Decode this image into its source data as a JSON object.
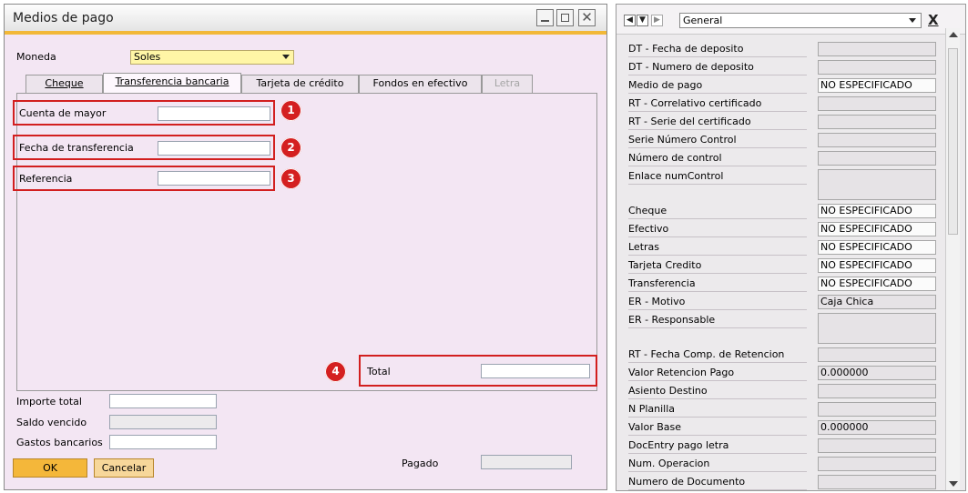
{
  "window": {
    "title": "Medios de pago"
  },
  "moneda": {
    "label": "Moneda",
    "value": "Soles"
  },
  "tabs": [
    {
      "label": "Cheque",
      "active": false,
      "disabled": false
    },
    {
      "label": "Transferencia bancaria",
      "active": true,
      "disabled": false
    },
    {
      "label": "Tarjeta de crédito",
      "active": false,
      "disabled": false
    },
    {
      "label": "Fondos en efectivo",
      "active": false,
      "disabled": false
    },
    {
      "label": "Letra",
      "active": false,
      "disabled": true
    }
  ],
  "transfer_fields": [
    {
      "label": "Cuenta de mayor",
      "value": "",
      "badge": "1"
    },
    {
      "label": "Fecha de transferencia",
      "value": "",
      "badge": "2"
    },
    {
      "label": "Referencia",
      "value": "",
      "badge": "3"
    }
  ],
  "total": {
    "label": "Total",
    "value": "",
    "badge": "4"
  },
  "summary": {
    "importe_total": {
      "label": "Importe total",
      "value": ""
    },
    "saldo_vencido": {
      "label": "Saldo vencido",
      "value": ""
    },
    "gastos_bancarios": {
      "label": "Gastos bancarios",
      "value": ""
    },
    "pagado": {
      "label": "Pagado",
      "value": ""
    }
  },
  "buttons": {
    "ok": "OK",
    "cancel": "Cancelar"
  },
  "side_panel": {
    "category": "General",
    "close": "X",
    "rows": [
      {
        "label": "DT - Fecha de deposito",
        "value": ""
      },
      {
        "label": "DT - Numero de deposito",
        "value": ""
      },
      {
        "label": "Medio de pago",
        "value": "NO ESPECIFICADO"
      },
      {
        "label": "RT - Correlativo certificado",
        "value": ""
      },
      {
        "label": "RT - Serie del certificado",
        "value": ""
      },
      {
        "label": "Serie Número Control",
        "value": ""
      },
      {
        "label": "Número de control",
        "value": ""
      },
      {
        "label": "Enlace numControl",
        "value": ""
      },
      {
        "label": "Cheque",
        "value": "NO ESPECIFICADO"
      },
      {
        "label": "Efectivo",
        "value": "NO ESPECIFICADO"
      },
      {
        "label": "Letras",
        "value": "NO ESPECIFICADO"
      },
      {
        "label": "Tarjeta Credito",
        "value": "NO ESPECIFICADO"
      },
      {
        "label": "Transferencia",
        "value": "NO ESPECIFICADO"
      },
      {
        "label": "ER - Motivo",
        "value": "Caja Chica"
      },
      {
        "label": "ER - Responsable",
        "value": ""
      },
      {
        "label": "RT - Fecha Comp. de Retencion",
        "value": ""
      },
      {
        "label": "Valor Retencion Pago",
        "value": "0.000000"
      },
      {
        "label": "Asiento Destino",
        "value": ""
      },
      {
        "label": "N Planilla",
        "value": ""
      },
      {
        "label": "Valor Base",
        "value": "0.000000"
      },
      {
        "label": "DocEntry pago letra",
        "value": ""
      },
      {
        "label": "Num. Operacion",
        "value": ""
      },
      {
        "label": "Numero de Documento",
        "value": ""
      }
    ]
  },
  "colors": {
    "highlight": "#d21f1f",
    "accent": "#f2b838",
    "form_bg": "#f3e6f3"
  }
}
